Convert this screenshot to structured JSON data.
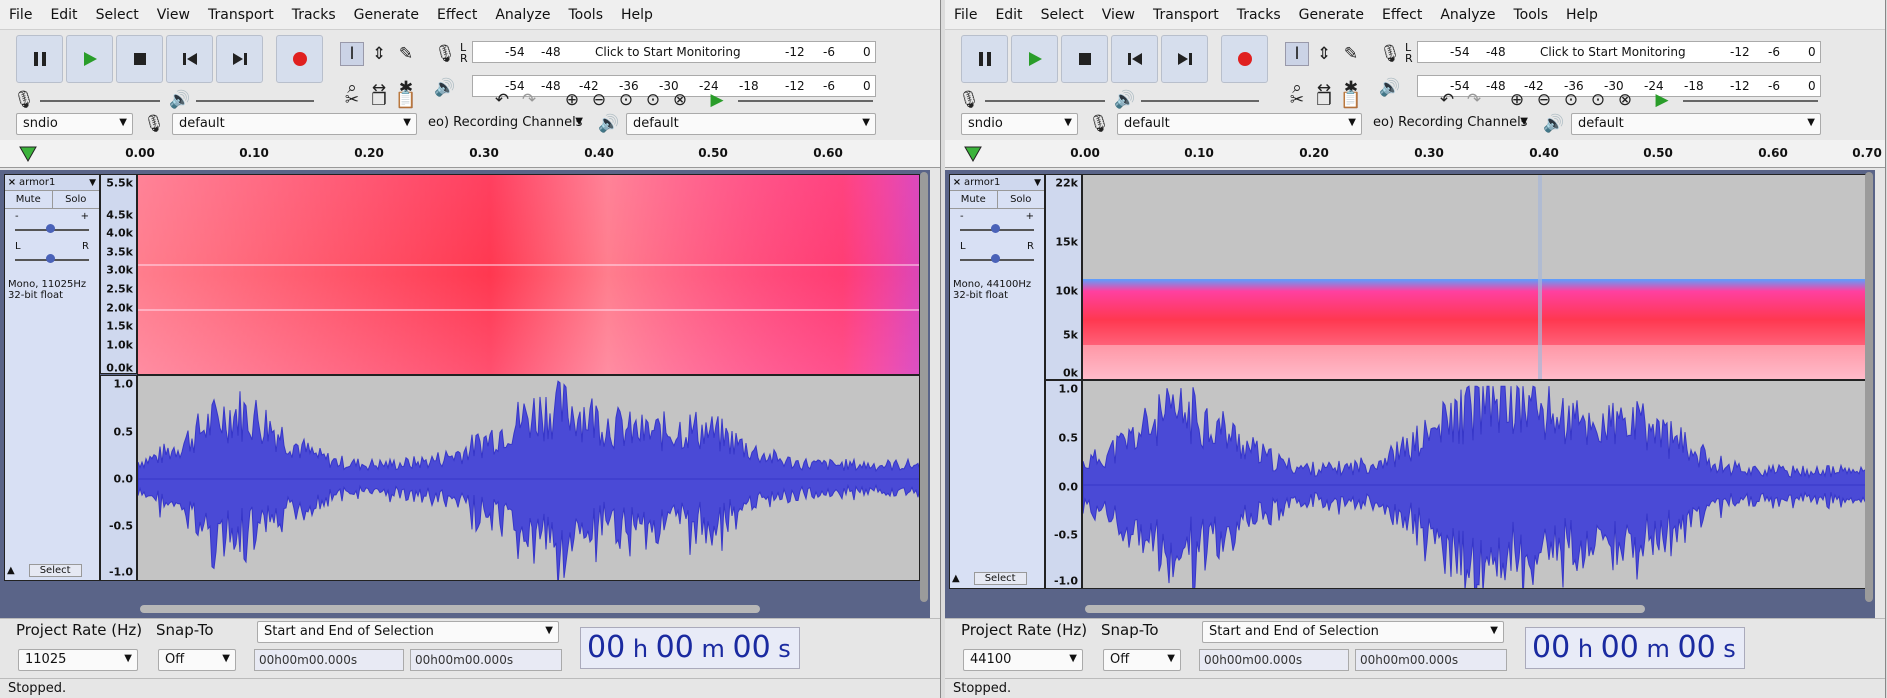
{
  "menus": [
    "File",
    "Edit",
    "Select",
    "View",
    "Transport",
    "Tracks",
    "Generate",
    "Effect",
    "Analyze",
    "Tools",
    "Help"
  ],
  "meter": {
    "ticks": [
      "-54",
      "-48",
      "-42",
      "-36",
      "-30",
      "-24",
      "-18",
      "-12",
      "-6",
      "0"
    ],
    "record_text": "Click to Start Monitoring",
    "lr": [
      "L",
      "R"
    ]
  },
  "device": {
    "host": "sndio",
    "recording_device": "default",
    "channels": "eo) Recording Channels",
    "playback_device": "default"
  },
  "ruler_left": [
    "0.00",
    "0.10",
    "0.20",
    "0.30",
    "0.40",
    "0.50",
    "0.60"
  ],
  "ruler_right": [
    "0.00",
    "0.10",
    "0.20",
    "0.30",
    "0.40",
    "0.50",
    "0.60",
    "0.70"
  ],
  "track": {
    "name": "armor1",
    "mute": "Mute",
    "solo": "Solo",
    "select": "Select",
    "gain_min": "-",
    "gain_max": "+",
    "pan_l": "L",
    "pan_r": "R"
  },
  "left": {
    "info": "Mono, 11025Hz",
    "format": "32-bit float",
    "rate": "11025",
    "spec_labels": [
      "5.5k",
      "4.5k",
      "4.0k",
      "3.5k",
      "3.0k",
      "2.5k",
      "2.0k",
      "1.5k",
      "1.0k",
      "0.0k"
    ]
  },
  "right": {
    "info": "Mono, 44100Hz",
    "format": "32-bit float",
    "rate": "44100",
    "spec_labels": [
      "22k",
      "15k",
      "10k",
      "5k",
      "0k"
    ]
  },
  "wave_labels": [
    "1.0",
    "0.5",
    "0.0",
    "-0.5",
    "-1.0"
  ],
  "bottom": {
    "project_rate_label": "Project Rate (Hz)",
    "snap_label": "Snap-To",
    "snap_value": "Off",
    "selection_mode": "Start and End of Selection",
    "sel_time": "00h00m00.000s",
    "big_time": {
      "h": "00",
      "m": "00",
      "s": "00"
    }
  },
  "status": "Stopped."
}
